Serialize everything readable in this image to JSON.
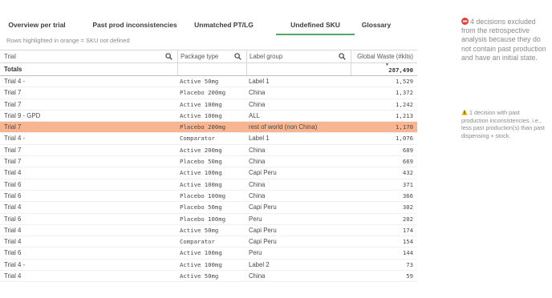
{
  "tabs": [
    {
      "label": "Overview per trial",
      "active": false
    },
    {
      "label": "Past prod inconsistencies",
      "active": false
    },
    {
      "label": "Unmatched PT/LG",
      "active": false
    },
    {
      "label": "Undefined SKU",
      "active": true
    },
    {
      "label": "Glossary",
      "active": false
    }
  ],
  "subtitle": "Rows highlighted in orange = SKU not defined",
  "table": {
    "headers": [
      "Trial",
      "Package type",
      "Label group",
      "Global Waste (#kits)"
    ],
    "totals": {
      "label": "Totals",
      "value": "287,490"
    },
    "rows": [
      {
        "trial": "Trial 4 -",
        "package": "Active 50mg",
        "label": "Label 1",
        "waste": "1,529",
        "highlight": false
      },
      {
        "trial": "Trial 7",
        "package": "Placebo 200mg",
        "label": "China",
        "waste": "1,372",
        "highlight": false
      },
      {
        "trial": "Trial 7",
        "package": "Active 100mg",
        "label": "China",
        "waste": "1,242",
        "highlight": false
      },
      {
        "trial": "Trial 9 - GPD",
        "package": "Active 100mg",
        "label": "ALL",
        "waste": "1,213",
        "highlight": false
      },
      {
        "trial": "Trial 7",
        "package": "Placebo 200mg",
        "label": "rest of world (non China)",
        "waste": "1,170",
        "highlight": true
      },
      {
        "trial": "Trial 4 -",
        "package": "Comparator",
        "label": "Label 1",
        "waste": "1,076",
        "highlight": false
      },
      {
        "trial": "Trial 7",
        "package": "Active 200mg",
        "label": "China",
        "waste": "689",
        "highlight": false
      },
      {
        "trial": "Trial 7",
        "package": "Placebo 50mg",
        "label": "China",
        "waste": "669",
        "highlight": false
      },
      {
        "trial": "Trial 4",
        "package": "Active 100mg",
        "label": "Capi Peru",
        "waste": "432",
        "highlight": false
      },
      {
        "trial": "Trial 6",
        "package": "Active 100mg",
        "label": "China",
        "waste": "371",
        "highlight": false
      },
      {
        "trial": "Trial 6",
        "package": "Placebo 100mg",
        "label": "China",
        "waste": "366",
        "highlight": false
      },
      {
        "trial": "Trial 4",
        "package": "Placebo 50mg",
        "label": "Capi Peru",
        "waste": "302",
        "highlight": false
      },
      {
        "trial": "Trial 6",
        "package": "Placebo 100mg",
        "label": "Peru",
        "waste": "202",
        "highlight": false
      },
      {
        "trial": "Trial 4",
        "package": "Active 50mg",
        "label": "Capi Peru",
        "waste": "174",
        "highlight": false
      },
      {
        "trial": "Trial 4",
        "package": "Comparator",
        "label": "Capi Peru",
        "waste": "154",
        "highlight": false
      },
      {
        "trial": "Trial 6",
        "package": "Active 100mg",
        "label": "Peru",
        "waste": "144",
        "highlight": false
      },
      {
        "trial": "Trial 4 -",
        "package": "Active 100mg",
        "label": "Label 2",
        "waste": "73",
        "highlight": false
      },
      {
        "trial": "Trial 4",
        "package": "Active 50mg",
        "label": "China",
        "waste": "59",
        "highlight": false
      }
    ]
  },
  "notes": {
    "excluded": "4 decisions excluded from the retrospective analysis because they do not contain past production and have an initial state.",
    "warning": "1 decision with past production inconsistencies, i.e., less past production(s) than past dispensing + stock."
  },
  "icons": {
    "excluded": "no-entry-icon",
    "warning": "warning-icon",
    "search": "search-icon"
  },
  "colors": {
    "accent": "#52a86a",
    "highlight": "#f7b591",
    "noEntry": "#e2403a",
    "warning": "#f2b600"
  }
}
